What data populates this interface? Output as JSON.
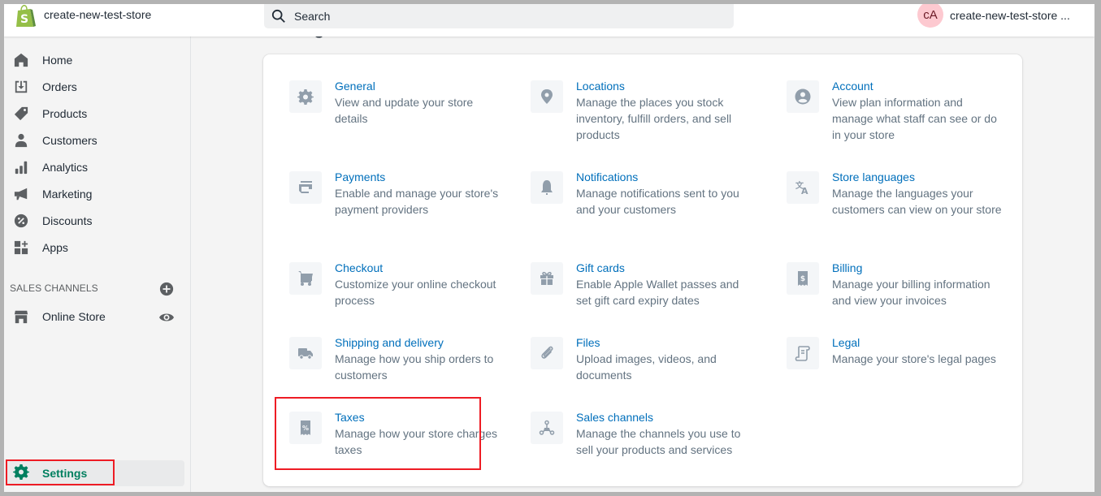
{
  "topbar": {
    "logo": "shopify-bag-icon",
    "store_name": "create-new-test-store",
    "search_placeholder": "Search",
    "avatar_initials": "cA",
    "user_name": "create-new-test-store ..."
  },
  "sidebar": {
    "items": [
      {
        "label": "Home",
        "icon": "home-icon"
      },
      {
        "label": "Orders",
        "icon": "orders-icon"
      },
      {
        "label": "Products",
        "icon": "tag-icon"
      },
      {
        "label": "Customers",
        "icon": "person-icon"
      },
      {
        "label": "Analytics",
        "icon": "bar-chart-icon"
      },
      {
        "label": "Marketing",
        "icon": "megaphone-icon"
      },
      {
        "label": "Discounts",
        "icon": "discount-icon"
      },
      {
        "label": "Apps",
        "icon": "apps-icon"
      }
    ],
    "sales_channels_heading": "SALES CHANNELS",
    "online_store": "Online Store",
    "settings": "Settings"
  },
  "main": {
    "page_title": "Settings",
    "tiles": [
      {
        "title": "General",
        "desc": "View and update your store details",
        "icon": "gear-icon"
      },
      {
        "title": "Locations",
        "desc": "Manage the places you stock inventory, fulfill orders, and sell products",
        "icon": "location-pin-icon"
      },
      {
        "title": "Account",
        "desc": "View plan information and manage what staff can see or do in your store",
        "icon": "account-icon"
      },
      {
        "title": "Payments",
        "desc": "Enable and manage your store's payment providers",
        "icon": "payment-card-icon"
      },
      {
        "title": "Notifications",
        "desc": "Manage notifications sent to you and your customers",
        "icon": "bell-icon"
      },
      {
        "title": "Store languages",
        "desc": "Manage the languages your customers can view on your store",
        "icon": "translate-icon"
      },
      {
        "title": "Checkout",
        "desc": "Customize your online checkout process",
        "icon": "cart-icon"
      },
      {
        "title": "Gift cards",
        "desc": "Enable Apple Wallet passes and set gift card expiry dates",
        "icon": "gift-icon"
      },
      {
        "title": "Billing",
        "desc": "Manage your billing information and view your invoices",
        "icon": "billing-receipt-icon"
      },
      {
        "title": "Shipping and delivery",
        "desc": "Manage how you ship orders to customers",
        "icon": "truck-icon"
      },
      {
        "title": "Files",
        "desc": "Upload images, videos, and documents",
        "icon": "paperclip-icon"
      },
      {
        "title": "Legal",
        "desc": "Manage your store's legal pages",
        "icon": "legal-scroll-icon"
      },
      {
        "title": "Taxes",
        "desc": "Manage how your store charges taxes",
        "icon": "tax-receipt-icon"
      },
      {
        "title": "Sales channels",
        "desc": "Manage the channels you use to sell your products and services",
        "icon": "channels-icon"
      }
    ]
  },
  "colors": {
    "link": "#006fbb",
    "active_nav": "#007f5f",
    "highlight": "#ee1c24",
    "avatar_bg": "#fdc9d0"
  }
}
